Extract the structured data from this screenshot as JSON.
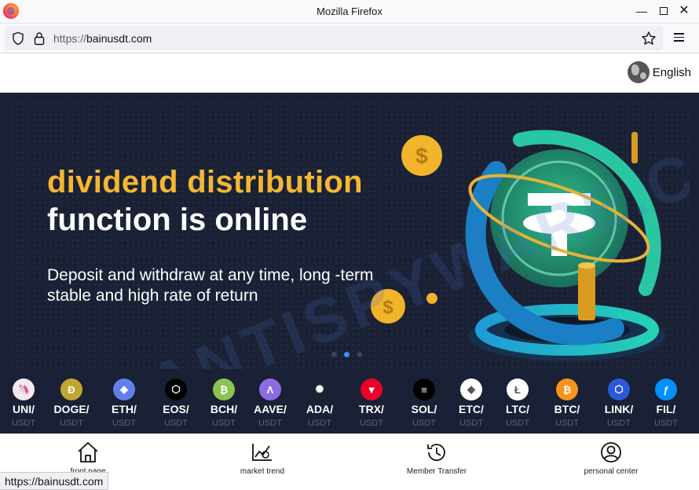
{
  "window": {
    "title": "Mozilla Firefox"
  },
  "urlbar": {
    "protocol": "https://",
    "host": "bainusdt.com"
  },
  "page": {
    "language": "English",
    "banner": {
      "headline_1": "dividend distribution",
      "headline_2": "function is online",
      "subtitle": "Deposit and withdraw at any time, long -term stable and high rate of return",
      "active_slide": 2,
      "slide_count": 3
    },
    "coins": [
      {
        "symbol": "UNI/",
        "quote": "USDT",
        "color": "#f6e9f0",
        "glyph": "🦄"
      },
      {
        "symbol": "DOGE/",
        "quote": "USDT",
        "color": "#c2a633",
        "glyph": "Ð"
      },
      {
        "symbol": "ETH/",
        "quote": "USDT",
        "color": "#627eea",
        "glyph": "◆"
      },
      {
        "symbol": "EOS/",
        "quote": "USDT",
        "color": "#000000",
        "glyph": "⬡"
      },
      {
        "symbol": "BCH/",
        "quote": "USDT",
        "color": "#8dc351",
        "glyph": "₿"
      },
      {
        "symbol": "AAVE/",
        "quote": "USDT",
        "color": "#8c6ce3",
        "glyph": "Λ"
      },
      {
        "symbol": "ADA/",
        "quote": "USDT",
        "color": "#1b2134",
        "glyph": "✺"
      },
      {
        "symbol": "TRX/",
        "quote": "USDT",
        "color": "#eb0029",
        "glyph": "▼"
      },
      {
        "symbol": "SOL/",
        "quote": "USDT",
        "color": "#000000",
        "glyph": "≡"
      },
      {
        "symbol": "ETC/",
        "quote": "USDT",
        "color": "#ffffff",
        "glyph": "◆"
      },
      {
        "symbol": "LTC/",
        "quote": "USDT",
        "color": "#ffffff",
        "glyph": "Ł"
      },
      {
        "symbol": "BTC/",
        "quote": "USDT",
        "color": "#f7931a",
        "glyph": "₿"
      },
      {
        "symbol": "LINK/",
        "quote": "USDT",
        "color": "#2a5ada",
        "glyph": "⬡"
      },
      {
        "symbol": "FIL/",
        "quote": "USDT",
        "color": "#0090ff",
        "glyph": "ƒ"
      }
    ],
    "bottom_nav": [
      {
        "label": "front page",
        "icon": "home-icon"
      },
      {
        "label": "market trend",
        "icon": "chart-icon"
      },
      {
        "label": "Member Transfer",
        "icon": "history-icon"
      },
      {
        "label": "personal center",
        "icon": "user-icon"
      }
    ],
    "watermark": "MYANTISPYWARE.COM"
  },
  "status_bar": {
    "link": "https://bainusdt.com"
  }
}
